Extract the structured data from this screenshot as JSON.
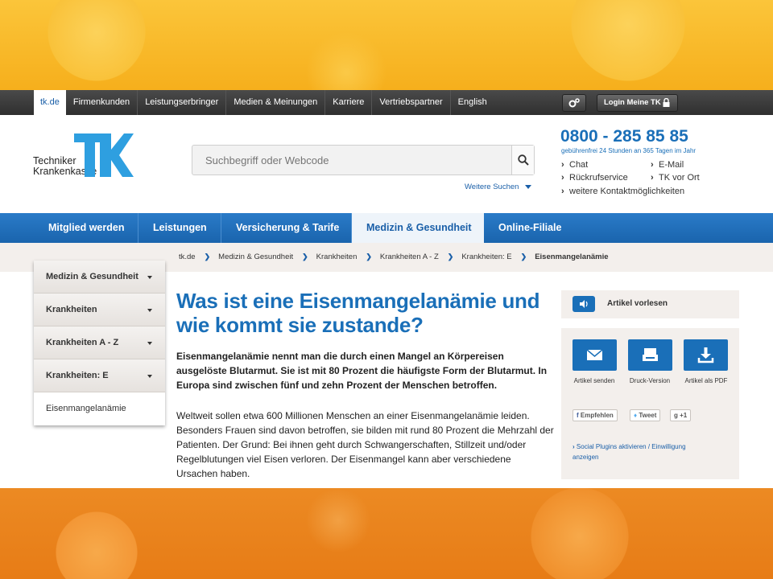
{
  "meta_nav": {
    "items": [
      "tk.de",
      "Firmenkunden",
      "Leistungserbringer",
      "Medien & Meinungen",
      "Karriere",
      "Vertriebspartner",
      "English"
    ],
    "login_label": "Login Meine TK"
  },
  "logo": {
    "line1": "Techniker",
    "line2": "Krankenkasse"
  },
  "search": {
    "placeholder": "Suchbegriff oder Webcode",
    "more_label": "Weitere Suchen"
  },
  "contact": {
    "phone": "0800 - 285 85 85",
    "phone_note": "gebührenfrei 24 Stunden an 365 Tagen im Jahr",
    "links": [
      "Chat",
      "E-Mail",
      "Rückrufservice",
      "TK vor Ort"
    ],
    "more": "weitere Kontaktmöglichkeiten"
  },
  "main_nav": {
    "items": [
      "Mitglied werden",
      "Leistungen",
      "Versicherung & Tarife",
      "Medizin & Gesundheit",
      "Online-Filiale"
    ],
    "active_index": 3
  },
  "breadcrumb": [
    "tk.de",
    "Medizin & Gesundheit",
    "Krankheiten",
    "Krankheiten A - Z",
    "Krankheiten: E",
    "Eisenmangelanämie"
  ],
  "sidenav": {
    "items": [
      "Medizin & Gesundheit",
      "Krankheiten",
      "Krankheiten A - Z",
      "Krankheiten: E"
    ],
    "current": "Eisenmangelanämie"
  },
  "article": {
    "title": "Was ist eine Eisenmangelanämie und wie kommt sie zustande?",
    "lead": "Eisenmangelanämie nennt man die durch einen Mangel an Körpereisen ausgelöste Blutarmut. Sie ist mit 80 Prozent die häufigste Form der Blutarmut. In Europa sind zwischen fünf und zehn Prozent der Menschen betroffen.",
    "body": "Weltweit sollen etwa 600 Millionen Menschen an einer Eisenmangelanämie leiden. Besonders Frauen sind davon betroffen, sie bilden mit rund 80 Prozent die Mehrzahl der Patienten. Der Grund: Bei ihnen geht durch Schwangerschaften, Stillzeit und/oder Regelblutungen viel Eisen verloren. Der Eisenmangel kann aber verschiedene Ursachen haben."
  },
  "tools": {
    "read_aloud": "Artikel vorlesen",
    "send": "Artikel senden",
    "print": "Druck-Version",
    "pdf": "Artikel als PDF",
    "facebook": "Empfehlen",
    "twitter": "Tweet",
    "gplus": "+1",
    "social_link": "Social Plugins aktivieren / Einwilligung anzeigen"
  },
  "colors": {
    "brand_blue": "#1a6fb8",
    "nav_blue": "#1a64ad",
    "accent_orange": "#f6b21f"
  }
}
